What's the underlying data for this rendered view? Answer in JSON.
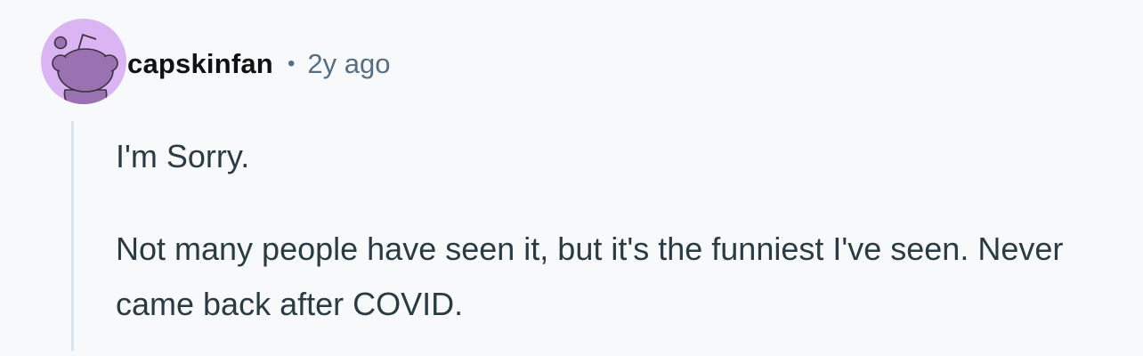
{
  "comment": {
    "author": "capskinfan",
    "separator": "•",
    "timestamp": "2y ago",
    "avatar_icon": "snoo-avatar-icon",
    "avatar_color": "#dbb4f3",
    "paragraphs": [
      "I'm Sorry.",
      "Not many people have seen it, but it's the funniest I've seen. Never came back after COVID."
    ]
  }
}
